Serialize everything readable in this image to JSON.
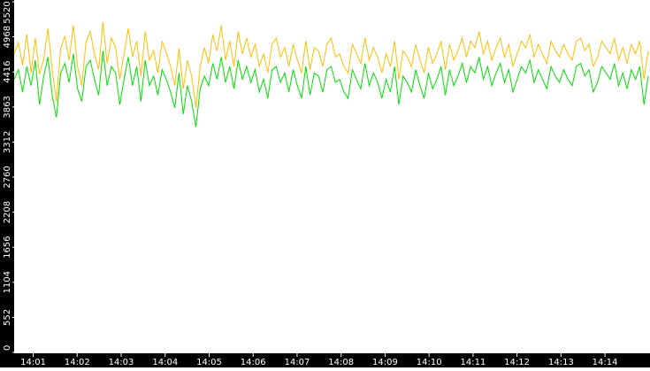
{
  "chart_data": {
    "type": "line",
    "title": "",
    "xlabel": "",
    "ylabel": "",
    "ylim": [
      0,
      5520
    ],
    "y_ticks": [
      0,
      552,
      1104,
      1656,
      2208,
      2760,
      3312,
      3863,
      4416,
      4968,
      5520
    ],
    "y_tick_labels": [
      "0",
      "552",
      "1104",
      "1656",
      "2208",
      "2760",
      "3312",
      "3863",
      "4416",
      "4968",
      "5520"
    ],
    "x_range": [
      "14:00:34",
      "14:14:59"
    ],
    "x_ticks": [
      "14:01",
      "14:02",
      "14:03",
      "14:04",
      "14:05",
      "14:06",
      "14:07",
      "14:08",
      "14:09",
      "14:10",
      "14:11",
      "14:12",
      "14:13",
      "14:14"
    ],
    "grid": false,
    "legend": "none",
    "colors": {
      "background": "#ffffff",
      "axis_band": "#000000",
      "axis_text": "#ffffff",
      "series_1": "#ffbf00",
      "series_2": "#00e000"
    },
    "series": [
      {
        "color": "#ffbf00",
        "values": [
          4700,
          4880,
          4520,
          5010,
          4400,
          4950,
          4380,
          4620,
          5100,
          4450,
          3950,
          4780,
          4980,
          4600,
          5150,
          4500,
          4200,
          4880,
          5050,
          4700,
          4450,
          5200,
          4550,
          4950,
          4800,
          4300,
          4700,
          5100,
          4650,
          4900,
          4350,
          5050,
          4600,
          4750,
          4400,
          4900,
          4720,
          4500,
          4200,
          4780,
          4150,
          4600,
          4350,
          3850,
          4500,
          4800,
          4550,
          5000,
          4750,
          5150,
          4600,
          4900,
          4500,
          5050,
          4700,
          4950,
          4650,
          4850,
          4500,
          4700,
          4400,
          4850,
          4950,
          4650,
          4800,
          4500,
          4850,
          4600,
          4400,
          4900,
          4450,
          4800,
          4750,
          4500,
          4850,
          4950,
          4650,
          4700,
          4500,
          4400,
          4850,
          4700,
          4550,
          4950,
          4600,
          4800,
          4650,
          4400,
          4700,
          4500,
          4900,
          4300,
          4750,
          4650,
          4500,
          4850,
          4600,
          4400,
          4800,
          4550,
          4700,
          4900,
          4450,
          4850,
          4600,
          4750,
          4950,
          4650,
          4900,
          4800,
          5050,
          4700,
          4900,
          4600,
          4800,
          4950,
          4650,
          4850,
          4500,
          4700,
          4900,
          4800,
          5000,
          4650,
          4850,
          4700,
          4550,
          4900,
          4750,
          4650,
          4850,
          4700,
          4600,
          4900,
          4950,
          4750,
          4850,
          4500,
          4650,
          4900,
          4800,
          4700,
          4950,
          4600,
          4800,
          4550,
          4850,
          4700,
          4900,
          4300,
          4750
        ]
      },
      {
        "color": "#00e000",
        "values": [
          4300,
          4450,
          4100,
          4500,
          4200,
          4600,
          3900,
          4350,
          4650,
          4050,
          3700,
          4400,
          4550,
          4250,
          4700,
          4150,
          3950,
          4500,
          4600,
          4300,
          4050,
          4750,
          4200,
          4500,
          4400,
          3900,
          4300,
          4650,
          4200,
          4500,
          3950,
          4600,
          4200,
          4350,
          4050,
          4450,
          4300,
          4100,
          3850,
          4400,
          3750,
          4200,
          3950,
          3550,
          4150,
          4350,
          4200,
          4550,
          4300,
          4650,
          4250,
          4500,
          4150,
          4600,
          4300,
          4500,
          4250,
          4450,
          4100,
          4300,
          4000,
          4450,
          4500,
          4250,
          4400,
          4100,
          4450,
          4200,
          4000,
          4500,
          4050,
          4400,
          4350,
          4100,
          4450,
          4500,
          4250,
          4300,
          4100,
          4000,
          4450,
          4300,
          4150,
          4550,
          4200,
          4400,
          4250,
          4000,
          4300,
          4100,
          4500,
          3900,
          4350,
          4250,
          4100,
          4450,
          4200,
          4000,
          4400,
          4150,
          4300,
          4500,
          4050,
          4450,
          4200,
          4350,
          4550,
          4250,
          4500,
          4400,
          4650,
          4300,
          4500,
          4200,
          4400,
          4550,
          4250,
          4450,
          4100,
          4300,
          4500,
          4400,
          4600,
          4250,
          4450,
          4300,
          4150,
          4500,
          4350,
          4250,
          4450,
          4300,
          4200,
          4500,
          4550,
          4350,
          4450,
          4100,
          4250,
          4500,
          4400,
          4300,
          4550,
          4200,
          4400,
          4150,
          4450,
          4300,
          4500,
          3900,
          4350
        ]
      }
    ]
  }
}
